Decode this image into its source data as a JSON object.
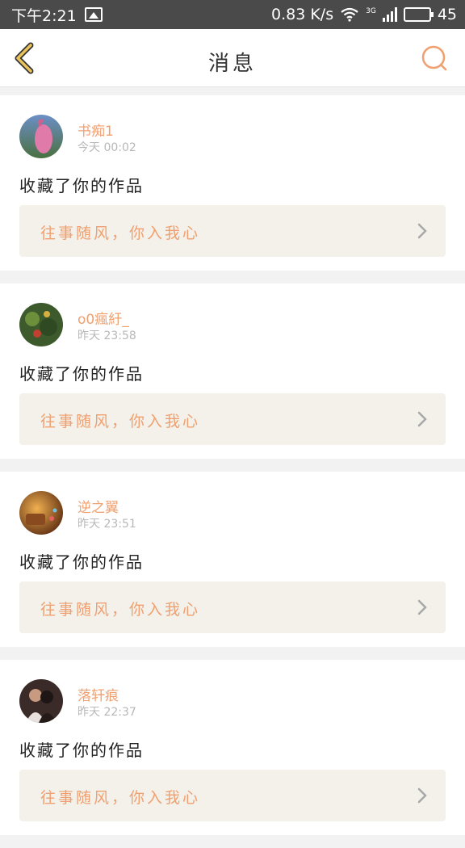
{
  "status_bar": {
    "time": "下午2:21",
    "net_speed": "0.83 K/s",
    "network_type": "3G",
    "battery": "45",
    "battery_level": 0.45
  },
  "header": {
    "title": "消息",
    "icons": {
      "back": "chevron-left-icon",
      "search": "search-icon"
    }
  },
  "colors": {
    "accent": "#f0a070",
    "back_icon": "#e8c45a",
    "work_bg": "#f3f1ea",
    "status_bar_bg": "#4a4a4a"
  },
  "notifications": [
    {
      "user": "书痴1",
      "time": "今天 00:02",
      "action": "收藏了你的作品",
      "work_title": "往事随风，你入我心"
    },
    {
      "user": "o0瘋紆_",
      "time": "昨天 23:58",
      "action": "收藏了你的作品",
      "work_title": "往事随风，你入我心"
    },
    {
      "user": "逆之翼",
      "time": "昨天 23:51",
      "action": "收藏了你的作品",
      "work_title": "往事随风，你入我心"
    },
    {
      "user": "落轩痕",
      "time": "昨天 22:37",
      "action": "收藏了你的作品",
      "work_title": "往事随风，你入我心"
    }
  ]
}
